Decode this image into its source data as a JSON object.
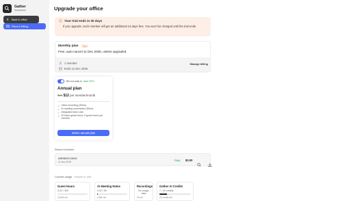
{
  "sidebar": {
    "workspace_name": "Gather",
    "workspace_sub": "Workplace",
    "back_label": "Back to office",
    "plans_label": "Plans & Billing"
  },
  "page": {
    "title": "Upgrade your office"
  },
  "trial_banner": {
    "title": "Your trial ends in 30 days",
    "body": "If you upgrade, each member will get an additional 14 days free. You won't be charged until the trial ends."
  },
  "current_plan": {
    "name": "Monthly plan",
    "badge": "Trial",
    "subtitle": "Free, auto-cancel 11 Dec 2025, unless upgraded.",
    "members": "1 member",
    "ends": "Ends 11 Dec 2025",
    "manage_label": "Manage billing"
  },
  "annual_plan": {
    "toggle_label": "Bill annually to",
    "save_text": "save 20%",
    "toggle_on": true,
    "title": "Annual plan",
    "old_price": "$15",
    "price": "$12",
    "price_suffix": "per member/month",
    "features": [
      "Video recording (30hrs)",
      "AI meeting summaries (30hrs)",
      "Integrated team chat",
      "30 base guest hours, 5 guest hours per member"
    ],
    "button_label": "Select annual plan"
  },
  "invoices": {
    "section_label": "Recent invoices",
    "items": [
      {
        "id": "AIE9DHO-0001",
        "date": "11 Nov 2025",
        "status": "Paid",
        "amount": "$0.00"
      }
    ]
  },
  "usage": {
    "section_label": "Current usage",
    "reset_text": "· Resets in 30d",
    "cards": [
      {
        "title": "Guest Hours",
        "value": "0.02 / 30h",
        "fill": 0.001,
        "left": "29.98h left"
      },
      {
        "title": "AI Meeting Notes",
        "value": "0.02 / 5h",
        "fill": 0.004,
        "left": "4.98h left"
      },
      {
        "title": "Recordings",
        "value": "No usage data",
        "left": "3h left"
      },
      {
        "title": "Gather AI Credits",
        "value": "7 / 30 credits",
        "fill": 0.233,
        "left": "23 credits left"
      }
    ]
  },
  "colors": {
    "accent": "#4a6cf7",
    "trial_bg": "#fdeee6",
    "paid_green": "#1e9e4a"
  }
}
